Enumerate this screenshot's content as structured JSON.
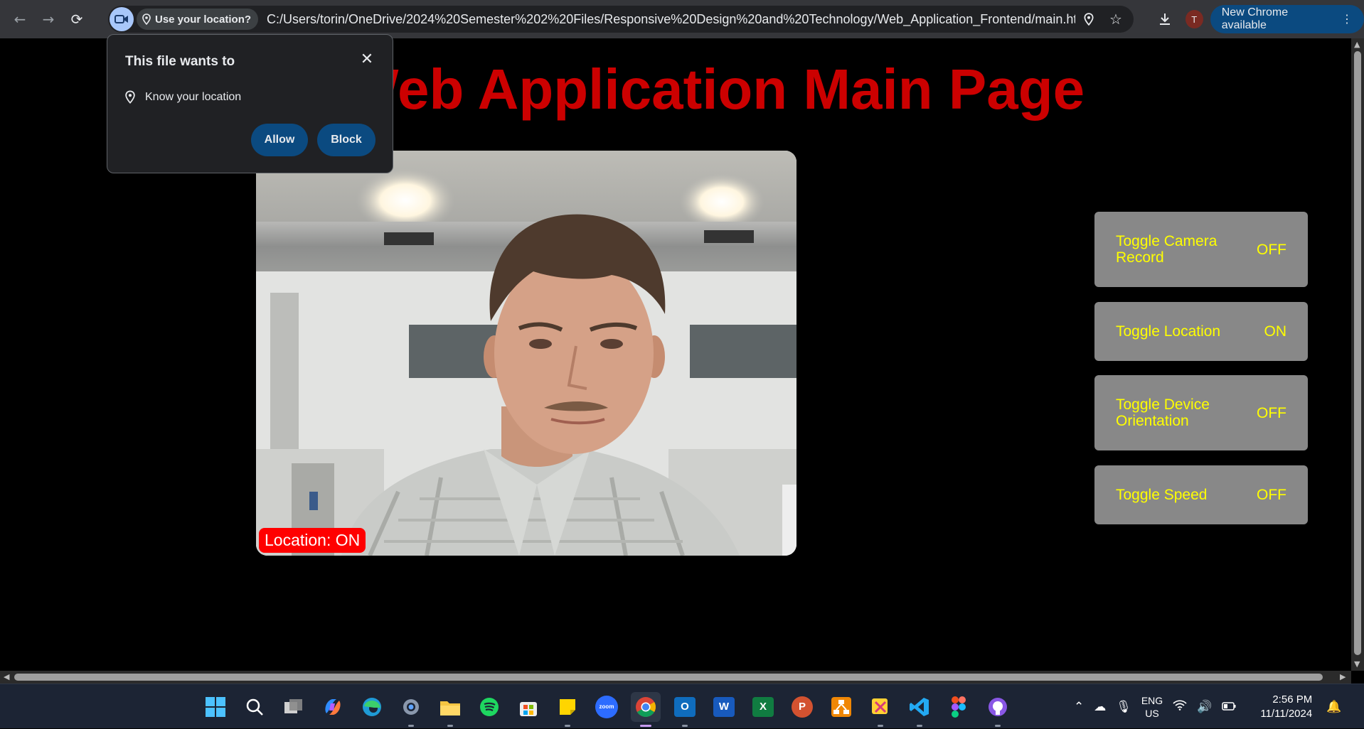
{
  "browser": {
    "nav": {
      "back": "←",
      "forward": "→",
      "reload": "⟳"
    },
    "permission_chip": "Use your location?",
    "url": "C:/Users/torin/OneDrive/2024%20Semester%202%20Files/Responsive%20Design%20and%20Technology/Web_Application_Frontend/main.html",
    "profile_initial": "T",
    "update_label": "New Chrome available",
    "menu": "⋮"
  },
  "popup": {
    "title": "This file wants to",
    "close": "✕",
    "request": "Know your location",
    "allow": "Allow",
    "block": "Block"
  },
  "page": {
    "title": "Web Application Main Page",
    "location_badge": "Location: ON",
    "toggles": [
      {
        "label": "Toggle Camera Record",
        "state": "OFF"
      },
      {
        "label": "Toggle Location",
        "state": "ON"
      },
      {
        "label": "Toggle Device Orientation",
        "state": "OFF"
      },
      {
        "label": "Toggle Speed",
        "state": "OFF"
      }
    ]
  },
  "taskbar": {
    "apps": [
      "windows-start",
      "search",
      "task-view",
      "copilot",
      "edge",
      "settings",
      "file-explorer",
      "spotify",
      "microsoft-store",
      "sticky-notes",
      "zoom",
      "chrome",
      "outlook",
      "word",
      "excel",
      "powerpoint",
      "drawio",
      "snipping-tool",
      "vscode",
      "figma",
      "github-desktop"
    ],
    "zoom_label": "zoom",
    "word_letter": "W",
    "excel_letter": "X",
    "powerpoint_letter": "P",
    "outlook_letter": "O",
    "lang_top": "ENG",
    "lang_bottom": "US",
    "time": "2:56 PM",
    "date": "11/11/2024"
  },
  "colors": {
    "title_red": "#cc0000",
    "toggle_bg": "#888888",
    "toggle_text": "#ffff00",
    "badge_red": "#ff0000",
    "button_blue": "#0b4a80"
  }
}
